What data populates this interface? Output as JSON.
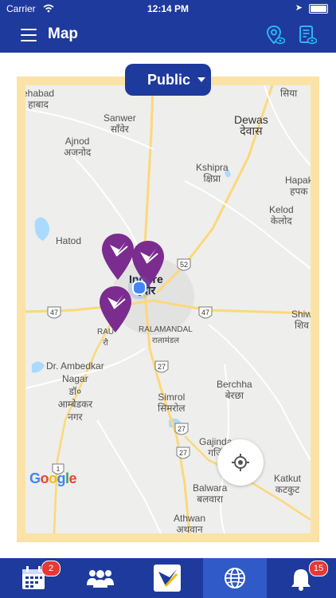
{
  "status_bar": {
    "carrier": "Carrier",
    "time": "12:14 PM"
  },
  "header": {
    "title": "Map",
    "menu_icon": "hamburger-icon",
    "actions": [
      "location-eye-icon",
      "document-eye-icon"
    ]
  },
  "filter": {
    "selected": "Public"
  },
  "map": {
    "labels": {
      "ehabad_en": "ehabad",
      "ehabad_hi": "हाबाद",
      "sanwer_en": "Sanwer",
      "sanwer_hi": "साँवेर",
      "siya_hi": "सिया",
      "dewas_en": "Dewas",
      "dewas_hi": "देवास",
      "ajnod_en": "Ajnod",
      "ajnod_hi": "अजनोद",
      "kshipra_en": "Kshipra",
      "kshipra_hi": "क्षिप्रा",
      "hapak_en": "Hapak",
      "hapak_hi": "हपक",
      "kelod_en": "Kelod",
      "kelod_hi": "केलोद",
      "hatod_en": "Hatod",
      "indore_en": "Indore",
      "indore_hi": "इंदौर",
      "rau_en": "RAU",
      "rau_hi": "रौ",
      "ralamandal_en": "RALAMANDAL",
      "ralamandal_hi": "रालामंडल",
      "shiw_en": "Shiw",
      "shiw_hi": "शिव",
      "ambedkar_en": "Dr. Ambedkar\nNagar",
      "ambedkar_hi": "डॉ०\nआम्बेडकर\nनगर",
      "berchha_en": "Berchha",
      "berchha_hi": "बेरछा",
      "simrol_en": "Simrol",
      "simrol_hi": "सिमरोल",
      "gajinda_en": "Gajinda",
      "gajinda_hi": "गजिं",
      "katkut_en": "Katkut",
      "katkut_hi": "कटकुट",
      "balwara_en": "Balwara",
      "balwara_hi": "बलवारा",
      "athwan_en": "Athwan",
      "athwan_hi": "अथवान"
    },
    "road_shields": [
      "52",
      "47",
      "47",
      "27",
      "27",
      "27",
      "1"
    ],
    "pins": 3,
    "attribution": "Google",
    "colors": {
      "pin": "#7b2c8f",
      "water": "#aadaff",
      "road": "#fcd87a",
      "frame": "#fbe3a7"
    }
  },
  "tabs": [
    {
      "icon": "calendar-icon",
      "badge": "2"
    },
    {
      "icon": "people-icon"
    },
    {
      "icon": "app-logo-icon"
    },
    {
      "icon": "globe-icon",
      "active": true
    },
    {
      "icon": "bell-icon",
      "badge": "15"
    }
  ],
  "colors": {
    "primary": "#1e3a9c",
    "badge": "#e53935"
  }
}
